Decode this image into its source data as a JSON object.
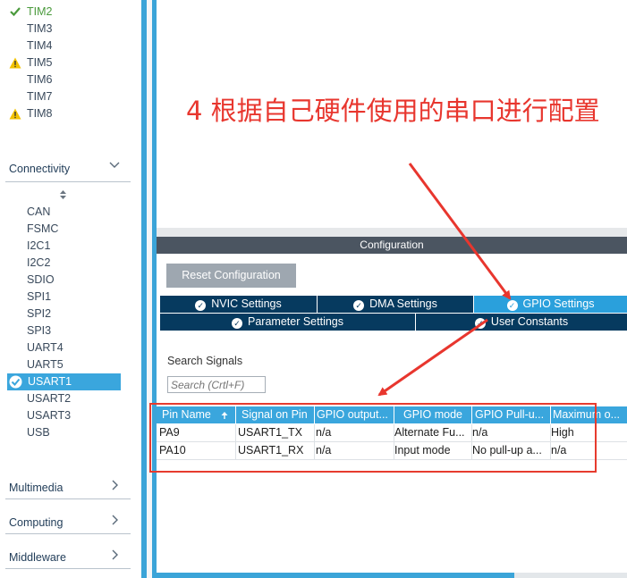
{
  "sidebar": {
    "timers": [
      {
        "label": "TIM2",
        "status": "ok"
      },
      {
        "label": "TIM3",
        "status": "none"
      },
      {
        "label": "TIM4",
        "status": "none"
      },
      {
        "label": "TIM5",
        "status": "warn"
      },
      {
        "label": "TIM6",
        "status": "none"
      },
      {
        "label": "TIM7",
        "status": "none"
      },
      {
        "label": "TIM8",
        "status": "warn"
      }
    ],
    "connectivity_title": "Connectivity",
    "connectivity_items": [
      "CAN",
      "FSMC",
      "I2C1",
      "I2C2",
      "SDIO",
      "SPI1",
      "SPI2",
      "SPI3",
      "UART4",
      "UART5",
      "USART1",
      "USART2",
      "USART3",
      "USB"
    ],
    "selected_item": "USART1",
    "multimedia_title": "Multimedia",
    "computing_title": "Computing",
    "middleware_title": "Middleware"
  },
  "annotation": {
    "text": "4 根据自己硬件使用的串口进行配置"
  },
  "configuration": {
    "header": "Configuration",
    "reset_label": "Reset Configuration",
    "tabs_row1": [
      {
        "label": "NVIC Settings",
        "active": false
      },
      {
        "label": "DMA Settings",
        "active": false
      },
      {
        "label": "GPIO Settings",
        "active": true
      }
    ],
    "tabs_row2": [
      {
        "label": "Parameter Settings",
        "active": false
      },
      {
        "label": "User Constants",
        "active": false
      }
    ],
    "search_label": "Search Signals",
    "search_placeholder": "Search (Crtl+F)"
  },
  "table": {
    "headers": [
      "Pin Name",
      "Signal on Pin",
      "GPIO output...",
      "GPIO mode",
      "GPIO Pull-u...",
      "Maximum o..."
    ],
    "rows": [
      [
        "PA9",
        "USART1_TX",
        "n/a",
        "Alternate Fu...",
        "n/a",
        "High"
      ],
      [
        "PA10",
        "USART1_RX",
        "n/a",
        "Input mode",
        "No pull-up a...",
        "n/a"
      ]
    ]
  },
  "colors": {
    "accent_blue": "#3aa6dd",
    "tab_dark": "#063a5f",
    "annotation_red": "#e8362e",
    "ok_green": "#4a9a3c",
    "warn_yellow": "#f2c200"
  }
}
